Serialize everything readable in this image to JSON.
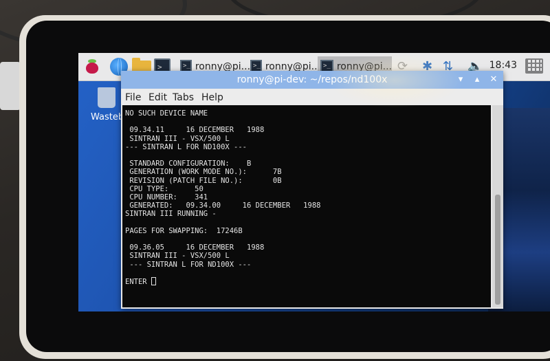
{
  "taskbar": {
    "icons": [
      "raspberry-pi-menu-icon",
      "web-browser-icon",
      "file-manager-icon",
      "terminal-icon"
    ],
    "tasks": [
      {
        "label": "ronny@pi..."
      },
      {
        "label": "ronny@pi..."
      },
      {
        "label": "ronny@pi..."
      }
    ],
    "clock": "18:43"
  },
  "desktop": {
    "trash_label": "Wasteba"
  },
  "window": {
    "title": "ronny@pi-dev: ~/repos/nd100x",
    "menu": [
      "File",
      "Edit",
      "Tabs",
      "Help"
    ]
  },
  "terminal": {
    "lines": [
      "NO SUCH DEVICE NAME",
      "",
      " 09.34.11     16 DECEMBER   1988",
      " SINTRAN III - VSX/500 L",
      "--- SINTRAN L FOR ND100X ---",
      "",
      " STANDARD CONFIGURATION:    B",
      " GENERATION (WORK MODE NO.):      7B",
      " REVISION (PATCH FILE NO.):       0B",
      " CPU TYPE:      50",
      " CPU NUMBER:    341",
      " GENERATED:   09.34.00     16 DECEMBER   1988",
      "SINTRAN III RUNNING -",
      "",
      "PAGES FOR SWAPPING:  17246B",
      "",
      " 09.36.05     16 DECEMBER   1988",
      " SINTRAN III - VSX/500 L",
      " --- SINTRAN L FOR ND100X ---",
      "",
      "ENTER "
    ]
  },
  "colors": {
    "titlebar": "#8fb5e8",
    "desktop": "#1c4fa8",
    "terminal_bg": "#0a0a0a"
  }
}
